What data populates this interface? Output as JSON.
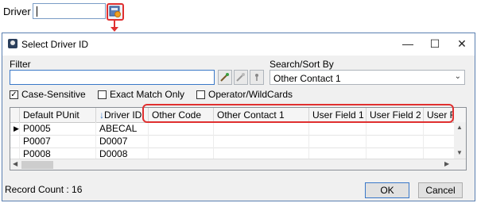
{
  "driver_field": {
    "label": "Driver",
    "value": "",
    "lookup_icon": "lookup-icon"
  },
  "dialog": {
    "title": "Select Driver ID",
    "window_controls": [
      "minimize",
      "maximize",
      "close"
    ],
    "filter": {
      "label": "Filter",
      "value": ""
    },
    "tool_icons": [
      "filter-wand-icon",
      "clear-filter-icon",
      "pin-icon"
    ],
    "search_sort": {
      "label": "Search/Sort By",
      "selected": "Other Contact 1"
    },
    "options": [
      {
        "label": "Case-Sensitive",
        "checked": true
      },
      {
        "label": "Exact Match Only",
        "checked": false
      },
      {
        "label": "Operator/WildCards",
        "checked": false
      }
    ],
    "grid": {
      "columns": [
        "Default PUnit",
        "Driver ID",
        "Other Code",
        "Other Contact 1",
        "User Field 1",
        "User Field 2",
        "User Fie"
      ],
      "sorted_column": "Driver ID",
      "rows": [
        [
          "P0005",
          "ABECAL",
          "",
          "",
          "",
          "",
          ""
        ],
        [
          "P0007",
          "D0007",
          "",
          "",
          "",
          "",
          ""
        ],
        [
          "P0008",
          "D0008",
          "",
          "",
          "",
          "",
          ""
        ]
      ],
      "current_row": 0
    },
    "record_count": "Record Count : 16",
    "ok_label": "OK",
    "cancel_label": "Cancel"
  },
  "colors": {
    "highlight": "#e03030",
    "accent": "#3a78c8"
  }
}
